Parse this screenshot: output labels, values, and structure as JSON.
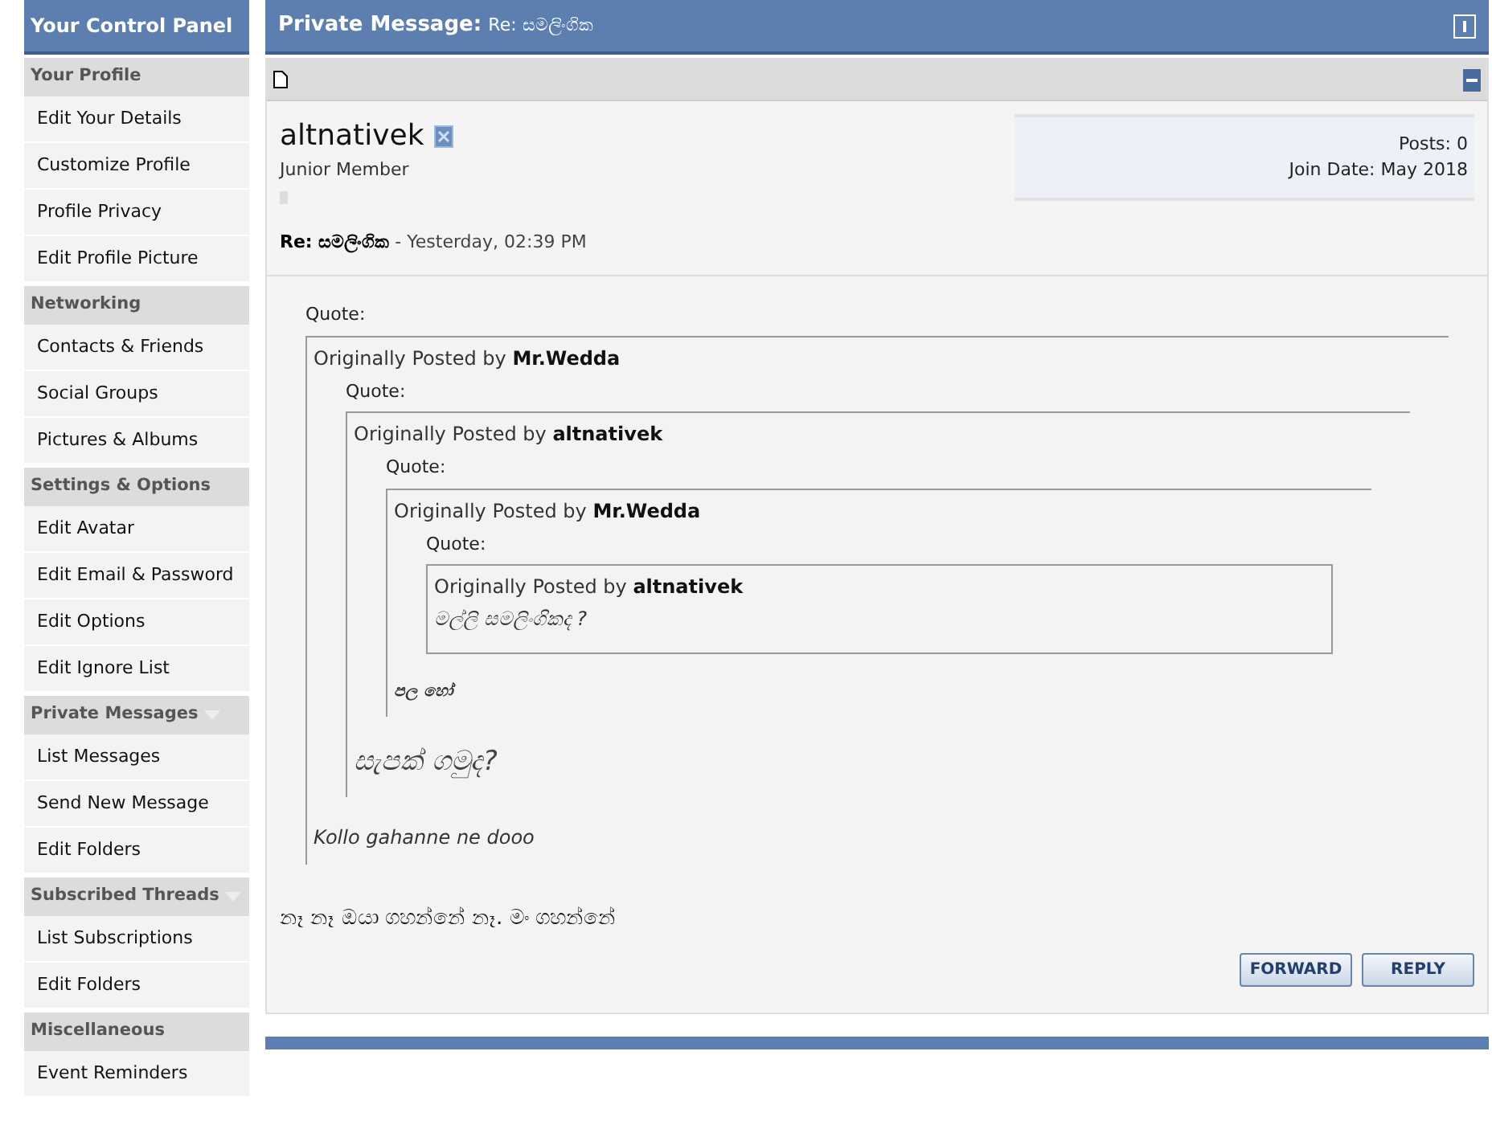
{
  "sidebar": {
    "title": "Your Control Panel",
    "sections": [
      {
        "title": "Your Profile",
        "collapsible": false,
        "items": [
          "Edit Your Details",
          "Customize Profile",
          "Profile Privacy",
          "Edit Profile Picture"
        ]
      },
      {
        "title": "Networking",
        "collapsible": false,
        "items": [
          "Contacts & Friends",
          "Social Groups",
          "Pictures & Albums"
        ]
      },
      {
        "title": "Settings & Options",
        "collapsible": false,
        "items": [
          "Edit Avatar",
          "Edit Email & Password",
          "Edit Options",
          "Edit Ignore List"
        ]
      },
      {
        "title": "Private Messages",
        "collapsible": true,
        "items": [
          "List Messages",
          "Send New Message",
          "Edit Folders"
        ]
      },
      {
        "title": "Subscribed Threads",
        "collapsible": true,
        "items": [
          "List Subscriptions",
          "Edit Folders"
        ]
      },
      {
        "title": "Miscellaneous",
        "collapsible": false,
        "items": [
          "Event Reminders"
        ]
      }
    ]
  },
  "header": {
    "label": "Private Message:",
    "subject": "Re: සමලිංගික"
  },
  "message": {
    "author": "altnativek",
    "rank": "Junior Member",
    "posts": "Posts: 0",
    "join_date": "Join Date: May 2018",
    "subject": "Re: සමලිංගික",
    "date": "- Yesterday, 02:39 PM",
    "quote": {
      "label": "Quote:",
      "prefix": "Originally Posted by",
      "author": "Mr.Wedda",
      "body": "Kollo gahanne ne dooo",
      "kind": "italic",
      "quote": {
        "label": "Quote:",
        "prefix": "Originally Posted by",
        "author": "altnativek",
        "body": "සැපක් ගමුද?",
        "kind": "large",
        "quote": {
          "label": "Quote:",
          "prefix": "Originally Posted by",
          "author": "Mr.Wedda",
          "body": "පල හෝ",
          "kind": "small",
          "quote": {
            "label": "Quote:",
            "prefix": "Originally Posted by",
            "author": "altnativek",
            "body": "මල්ලි සමලිංගිකද ?",
            "kind": "italic"
          }
        }
      }
    },
    "text": "නෑ නෑ ඔයා ගහන්නේ නෑ. මං ගහන්නේ"
  },
  "buttons": [
    "FORWARD",
    "REPLY"
  ]
}
